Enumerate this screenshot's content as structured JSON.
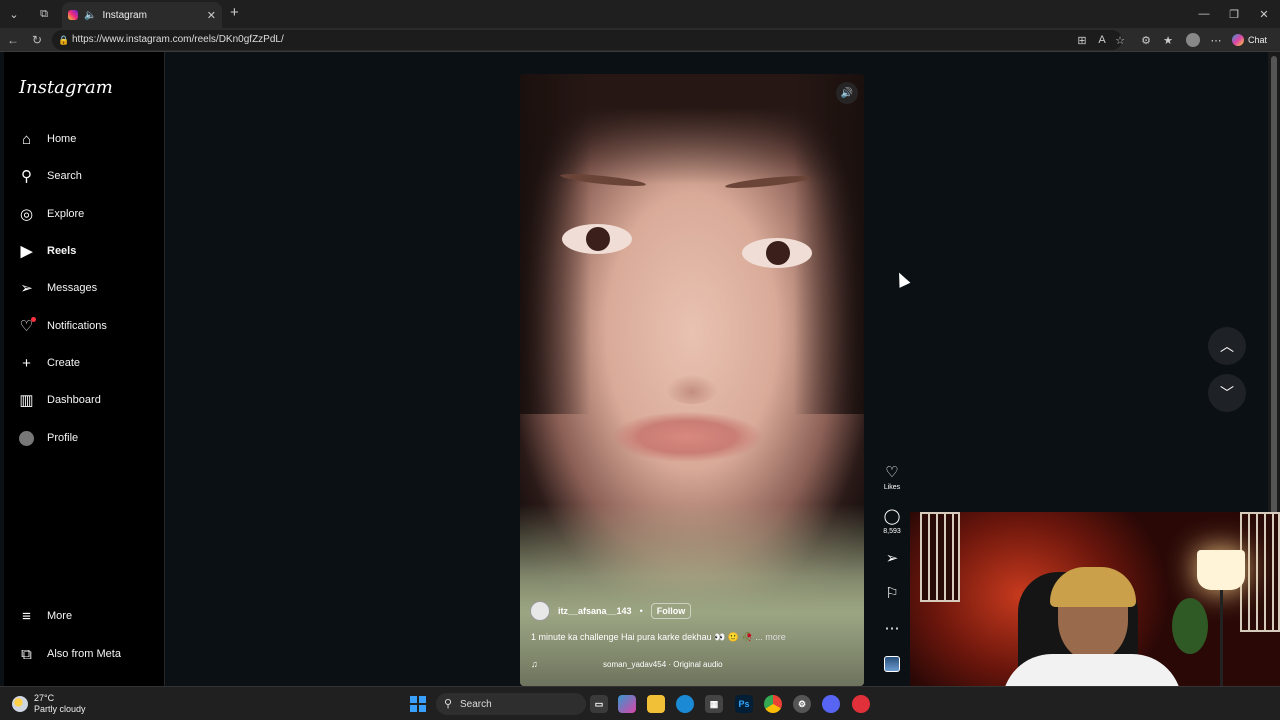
{
  "browser": {
    "tab_title": "Instagram",
    "url": "https://www.instagram.com/reels/DKn0gfZzPdL/",
    "chat_label": "Chat"
  },
  "sidebar": {
    "logo": "Instagram",
    "items": [
      {
        "label": "Home",
        "icon": "home-icon"
      },
      {
        "label": "Search",
        "icon": "search-icon"
      },
      {
        "label": "Explore",
        "icon": "compass-icon"
      },
      {
        "label": "Reels",
        "icon": "reels-icon",
        "active": true
      },
      {
        "label": "Messages",
        "icon": "send-icon"
      },
      {
        "label": "Notifications",
        "icon": "heart-icon"
      },
      {
        "label": "Create",
        "icon": "plus-icon"
      },
      {
        "label": "Dashboard",
        "icon": "chart-icon"
      },
      {
        "label": "Profile",
        "icon": "profile-avatar"
      }
    ],
    "more": "More",
    "also_from_meta": "Also from Meta"
  },
  "reel": {
    "username": "itz__afsana__143",
    "separator": "•",
    "follow_label": "Follow",
    "caption": "1 minute ka challenge Hai pura karke dekhau 👀 🙂 🥀",
    "more_label": "... more",
    "audio": "soman_yadav454 · Original audio"
  },
  "actions": {
    "likes_label": "Likes",
    "comments_count": "8,593"
  },
  "taskbar": {
    "temperature": "27°C",
    "condition": "Partly cloudy",
    "search_label": "Search"
  },
  "colors": {
    "accent_red": "#ff3040",
    "page_bg": "#0b1014"
  }
}
